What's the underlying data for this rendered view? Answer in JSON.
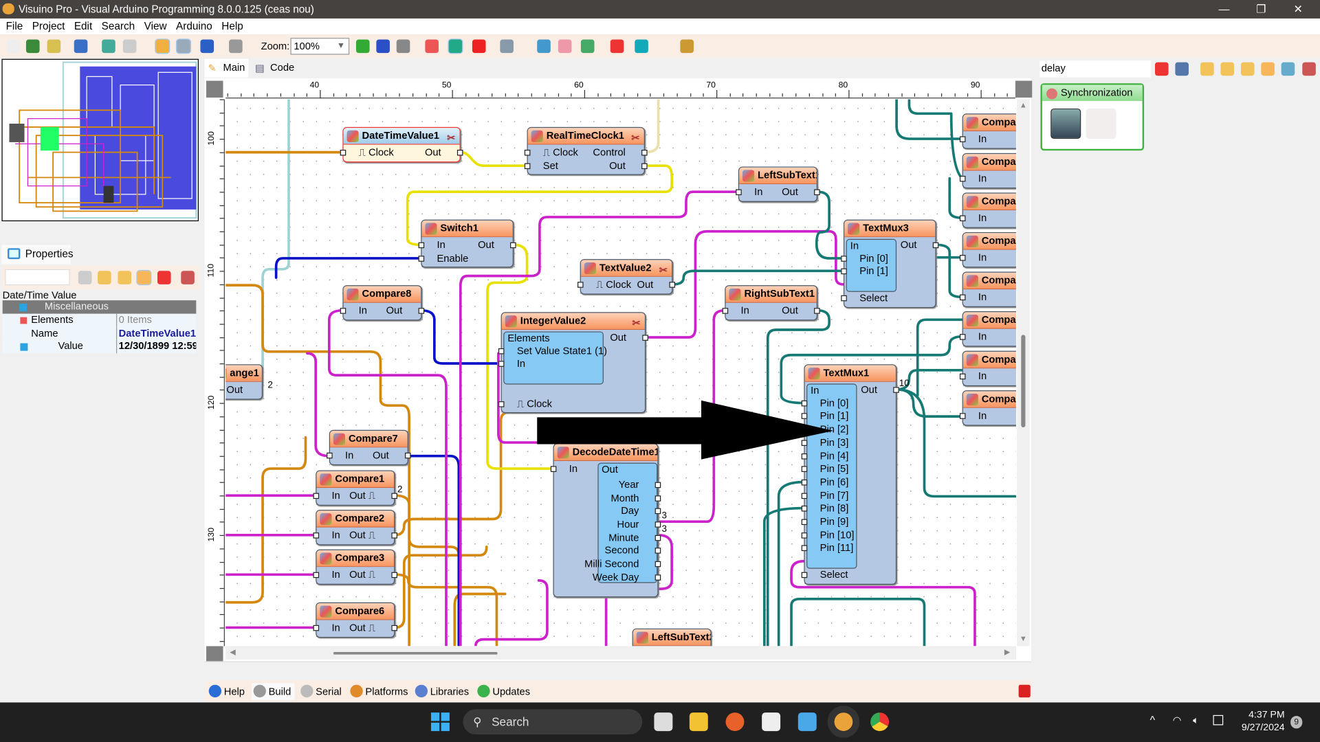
{
  "window": {
    "title": "Visuino Pro - Visual Arduino Programming 8.0.0.125 (ceas nou)",
    "controls": [
      "minimize",
      "restore",
      "close"
    ]
  },
  "menu": [
    "File",
    "Project",
    "Edit",
    "Search",
    "View",
    "Arduino",
    "Help"
  ],
  "toolbar": {
    "zoom_label": "Zoom:",
    "zoom_value": "100%",
    "icons": [
      "new-icon",
      "open-examples-icon",
      "open-icon",
      "save-icon",
      "add-library-icon",
      "copy-icon",
      "ruler-icon",
      "grid-icon",
      "undo-icon",
      "redo-icon",
      "zoom-in-icon",
      "zoom-fit-icon",
      "zoom-out-icon",
      "refresh-icon",
      "route-wire-icon",
      "delete-icon",
      "preview-icon",
      "components-icon",
      "folder-icon",
      "board-icon",
      "stop-icon",
      "connect-icon",
      "dark-mode-icon"
    ]
  },
  "editor_tabs": [
    {
      "label": "Main",
      "active": true
    },
    {
      "label": "Code",
      "active": false
    }
  ],
  "rulers": {
    "top": [
      "40",
      "50",
      "60",
      "70",
      "80",
      "90"
    ],
    "left": [
      "100",
      "110",
      "120",
      "130"
    ]
  },
  "properties": {
    "tab": "Properties",
    "search_value": "",
    "heading": "Date/Time Value",
    "category": "Miscellaneous",
    "rows": [
      {
        "key": "Elements",
        "value": "0 Items"
      },
      {
        "key": "Name",
        "value": "DateTimeValue1"
      },
      {
        "key": "Value",
        "value": "12/30/1899 12:59..."
      }
    ]
  },
  "nodes": [
    {
      "id": "datetimevalue1",
      "title": "DateTimeValue1",
      "selected": true,
      "rows": [
        {
          "l": "⎍ Clock",
          "r": "Out"
        }
      ]
    },
    {
      "id": "realtimeclock1",
      "title": "RealTimeClock1",
      "rows": [
        {
          "l": "⎍ Clock",
          "r": "Control"
        },
        {
          "l": "Set",
          "r": "Out"
        }
      ]
    },
    {
      "id": "switch1",
      "title": "Switch1",
      "rows": [
        {
          "l": "In",
          "r": "Out"
        },
        {
          "l": "Enable",
          "r": ""
        }
      ]
    },
    {
      "id": "leftsubtext1",
      "title": "LeftSubText1",
      "rows": [
        {
          "l": "In",
          "r": "Out"
        }
      ]
    },
    {
      "id": "textvalue2",
      "title": "TextValue2",
      "rows": [
        {
          "l": "⎍ Clock",
          "r": "Out"
        }
      ]
    },
    {
      "id": "textmux3",
      "title": "TextMux3",
      "inner_label": "In",
      "rows": [
        {
          "l": "",
          "r": "Out",
          "inner": true
        },
        {
          "l": "Pin [0]",
          "r": "",
          "inner": true
        },
        {
          "l": "Pin [1]",
          "r": "",
          "inner": true
        },
        {
          "l": "Select",
          "r": ""
        }
      ]
    },
    {
      "id": "compare8",
      "title": "Compare8",
      "rows": [
        {
          "l": "In",
          "r": "Out"
        }
      ]
    },
    {
      "id": "rightsubtext1",
      "title": "RightSubText1",
      "rows": [
        {
          "l": "In",
          "r": "Out"
        }
      ]
    },
    {
      "id": "integervalue2",
      "title": "IntegerValue2",
      "inner_label": "Elements",
      "rows": [
        {
          "l": "",
          "r": "Out",
          "inner": true
        },
        {
          "l": "Set Value State1 (1)",
          "r": "",
          "inner": true
        },
        {
          "l": "In",
          "r": "",
          "inner": true
        },
        {
          "l": "",
          "r": ""
        },
        {
          "l": "⎍ Clock",
          "r": ""
        }
      ]
    },
    {
      "id": "range1",
      "title": "ange1",
      "rows": [
        {
          "l": "Out",
          "r": ""
        }
      ]
    },
    {
      "id": "textmux1",
      "title": "TextMux1",
      "inner_label": "In",
      "rows": [
        {
          "l": "",
          "r": "Out",
          "inner": true
        },
        {
          "l": "Pin [0]",
          "r": "",
          "inner": true
        },
        {
          "l": "Pin [1]",
          "r": "",
          "inner": true
        },
        {
          "l": "Pin [2]",
          "r": "",
          "inner": true
        },
        {
          "l": "Pin [3]",
          "r": "",
          "inner": true
        },
        {
          "l": "Pin [4]",
          "r": "",
          "inner": true
        },
        {
          "l": "Pin [5]",
          "r": "",
          "inner": true
        },
        {
          "l": "Pin [6]",
          "r": "",
          "inner": true
        },
        {
          "l": "Pin [7]",
          "r": "",
          "inner": true
        },
        {
          "l": "Pin [8]",
          "r": "",
          "inner": true
        },
        {
          "l": "Pin [9]",
          "r": "",
          "inner": true
        },
        {
          "l": "Pin [10]",
          "r": "",
          "inner": true
        },
        {
          "l": "Pin [11]",
          "r": "",
          "inner": true
        },
        {
          "l": "Select",
          "r": ""
        }
      ]
    },
    {
      "id": "compare7",
      "title": "Compare7",
      "rows": [
        {
          "l": "In",
          "r": "Out"
        }
      ]
    },
    {
      "id": "decodedatetime1",
      "title": "DecodeDateTime1",
      "inner_label": "Out",
      "rows": [
        {
          "l": "In",
          "r": ""
        },
        {
          "l": "",
          "r": "Year",
          "innerR": true
        },
        {
          "l": "",
          "r": "Month",
          "innerR": true
        },
        {
          "l": "",
          "r": "Day",
          "innerR": true
        },
        {
          "l": "",
          "r": "Hour",
          "innerR": true
        },
        {
          "l": "",
          "r": "Minute",
          "innerR": true
        },
        {
          "l": "",
          "r": "Second",
          "innerR": true
        },
        {
          "l": "",
          "r": "Milli Second",
          "innerR": true
        },
        {
          "l": "",
          "r": "Week Day",
          "innerR": true
        }
      ]
    },
    {
      "id": "compare1",
      "title": "Compare1",
      "rows": [
        {
          "l": "In",
          "r": "Out ⎍"
        }
      ]
    },
    {
      "id": "compare2",
      "title": "Compare2",
      "rows": [
        {
          "l": "In",
          "r": "Out ⎍"
        }
      ]
    },
    {
      "id": "compare3",
      "title": "Compare3",
      "rows": [
        {
          "l": "In",
          "r": "Out ⎍"
        }
      ]
    },
    {
      "id": "compare6",
      "title": "Compare6",
      "rows": [
        {
          "l": "In",
          "r": "Out ⎍"
        }
      ]
    },
    {
      "id": "leftsubtext2",
      "title": "LeftSubText2",
      "rows": []
    },
    {
      "id": "compar-a",
      "title": "Compar",
      "rows": [
        {
          "l": "In",
          "r": ""
        }
      ]
    },
    {
      "id": "compar-b",
      "title": "Compar",
      "rows": [
        {
          "l": "In",
          "r": ""
        }
      ]
    },
    {
      "id": "compar-c",
      "title": "Compar",
      "rows": [
        {
          "l": "In",
          "r": ""
        }
      ]
    },
    {
      "id": "compar-d",
      "title": "Compar",
      "rows": [
        {
          "l": "In",
          "r": ""
        }
      ]
    },
    {
      "id": "compar-e",
      "title": "Compar",
      "rows": [
        {
          "l": "In",
          "r": ""
        }
      ]
    },
    {
      "id": "compar-f",
      "title": "Compar",
      "rows": [
        {
          "l": "In",
          "r": ""
        }
      ]
    },
    {
      "id": "compar-g",
      "title": "Compar",
      "rows": [
        {
          "l": "In",
          "r": ""
        }
      ]
    },
    {
      "id": "compar-h",
      "title": "Compar",
      "rows": [
        {
          "l": "In",
          "r": ""
        }
      ]
    }
  ],
  "wire_counts": [
    "2",
    "2",
    "3",
    "3",
    "10"
  ],
  "wire_colors": {
    "clock": "#d4880e",
    "datetime": "#e8e000",
    "text": "#167a74",
    "integer": "#cc22cc",
    "boolean": "#0a12c8",
    "control": "#e9e2a8",
    "analog": "#9fd3d3"
  },
  "right_panel": {
    "search_value": "delay",
    "category": "Synchronization",
    "icons": [
      "clear-filter-icon",
      "wizard-icon",
      "expand-icon",
      "collapse-icon",
      "group-icon",
      "sort-icon",
      "numeric-icon",
      "close-filter-icon"
    ]
  },
  "bottom_tabs": [
    "Help",
    "Build",
    "Serial",
    "Platforms",
    "Libraries",
    "Updates"
  ],
  "taskbar": {
    "search": "Search",
    "time": "4:37 PM",
    "date": "9/27/2024",
    "notifications": "9"
  }
}
